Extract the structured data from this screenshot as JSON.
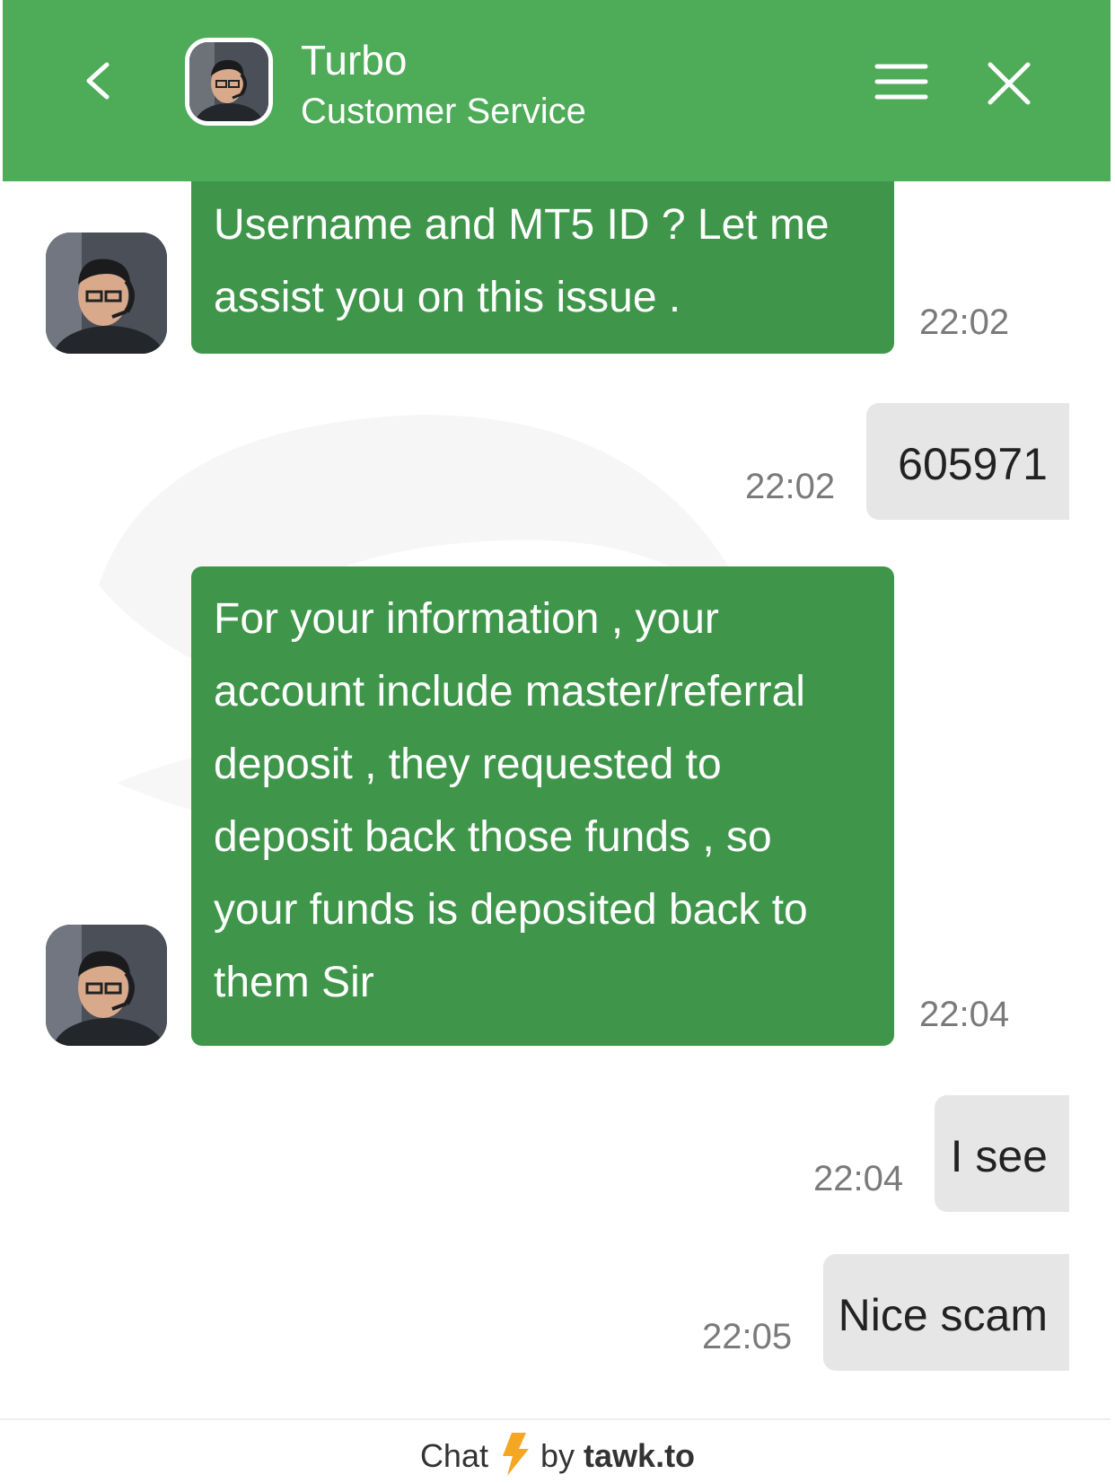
{
  "header": {
    "agent_name": "Turbo",
    "agent_subtitle": "Customer Service",
    "back_icon": "chevron-left-icon",
    "menu_icon": "hamburger-menu-icon",
    "close_icon": "close-icon",
    "background_color": "#4eab58"
  },
  "messages": [
    {
      "sender": "agent",
      "text": "Username and MT5 ID ? Let me\nassist you on this issue .",
      "time": "22:02"
    },
    {
      "sender": "user",
      "text": "605971",
      "time": "22:02"
    },
    {
      "sender": "agent",
      "text": "For your information , your\naccount include master/referral\ndeposit , they requested to\ndeposit back those funds , so\nyour funds is deposited back to\nthem Sir",
      "time": "22:04"
    },
    {
      "sender": "user",
      "text": "I see",
      "time": "22:04"
    },
    {
      "sender": "user",
      "text": "Nice scam",
      "time": "22:05"
    }
  ],
  "colors": {
    "agent_bubble": "#3f964b",
    "user_bubble": "#e6e6e6",
    "timestamp": "#7a7a7a",
    "bolt": "#f5a623"
  },
  "footer": {
    "chat_label": "Chat",
    "by_label": "by",
    "brand": "tawk.to",
    "icon": "lightning-bolt-icon"
  }
}
